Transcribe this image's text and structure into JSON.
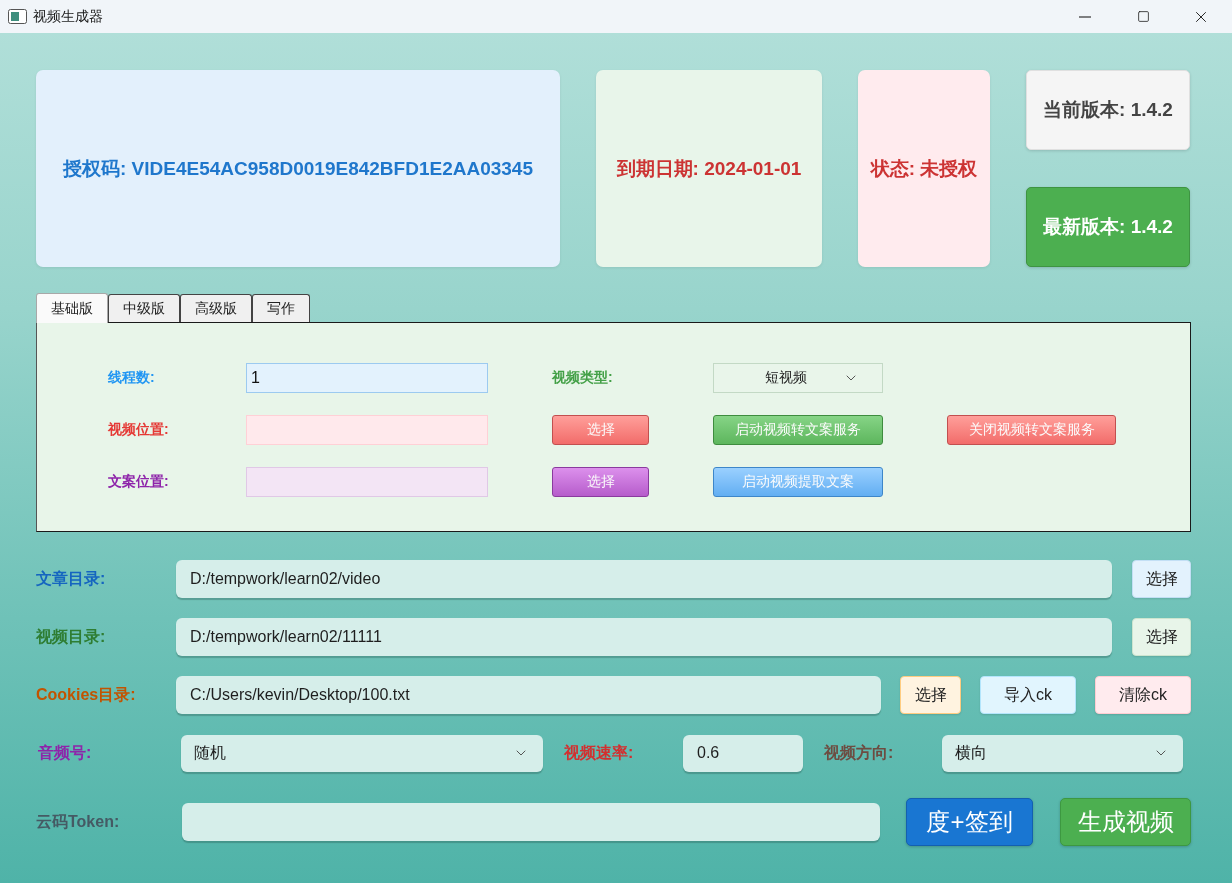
{
  "window": {
    "title": "视频生成器"
  },
  "license_card": {
    "text": "授权码: VIDE4E54AC958D0019E842BFD1E2AA03345"
  },
  "expiry_card": {
    "text": "到期日期: 2024-01-01"
  },
  "status_card": {
    "text": "状态: 未授权"
  },
  "version": {
    "current": "当前版本: 1.4.2",
    "latest": "最新版本: 1.4.2"
  },
  "tabs": [
    {
      "label": "基础版",
      "selected": true
    },
    {
      "label": "中级版",
      "selected": false
    },
    {
      "label": "高级版",
      "selected": false
    },
    {
      "label": "写作",
      "selected": false
    }
  ],
  "basic_panel": {
    "thread_count": {
      "label": "线程数:",
      "value": "1"
    },
    "video_type": {
      "label": "视频类型:",
      "value": "短视频"
    },
    "video_location": {
      "label": "视频位置:",
      "button": "选择"
    },
    "copy_location": {
      "label": "文案位置:",
      "button": "选择"
    },
    "start_transcribe_button": "启动视频转文案服务",
    "stop_transcribe_button": "关闭视频转文案服务",
    "extract_copy_button": "启动视频提取文案"
  },
  "article_dir": {
    "label": "文章目录:",
    "value": "D:/tempwork/learn02/video",
    "button": "选择"
  },
  "video_dir": {
    "label": "视频目录:",
    "value": "D:/tempwork/learn02/11111",
    "button": "选择"
  },
  "cookies_dir": {
    "label": "Cookies目录:",
    "value": "C:/Users/kevin/Desktop/100.txt",
    "buttons": [
      "选择",
      "导入ck",
      "清除ck"
    ]
  },
  "audio": {
    "label": "音频号:",
    "value": "随机"
  },
  "video_speed": {
    "label": "视频速率:",
    "value": "0.6"
  },
  "video_direction": {
    "label": "视频方向:",
    "value": "横向"
  },
  "token": {
    "label": "云码Token:"
  },
  "actions": [
    "度+签到",
    "生成视频"
  ]
}
